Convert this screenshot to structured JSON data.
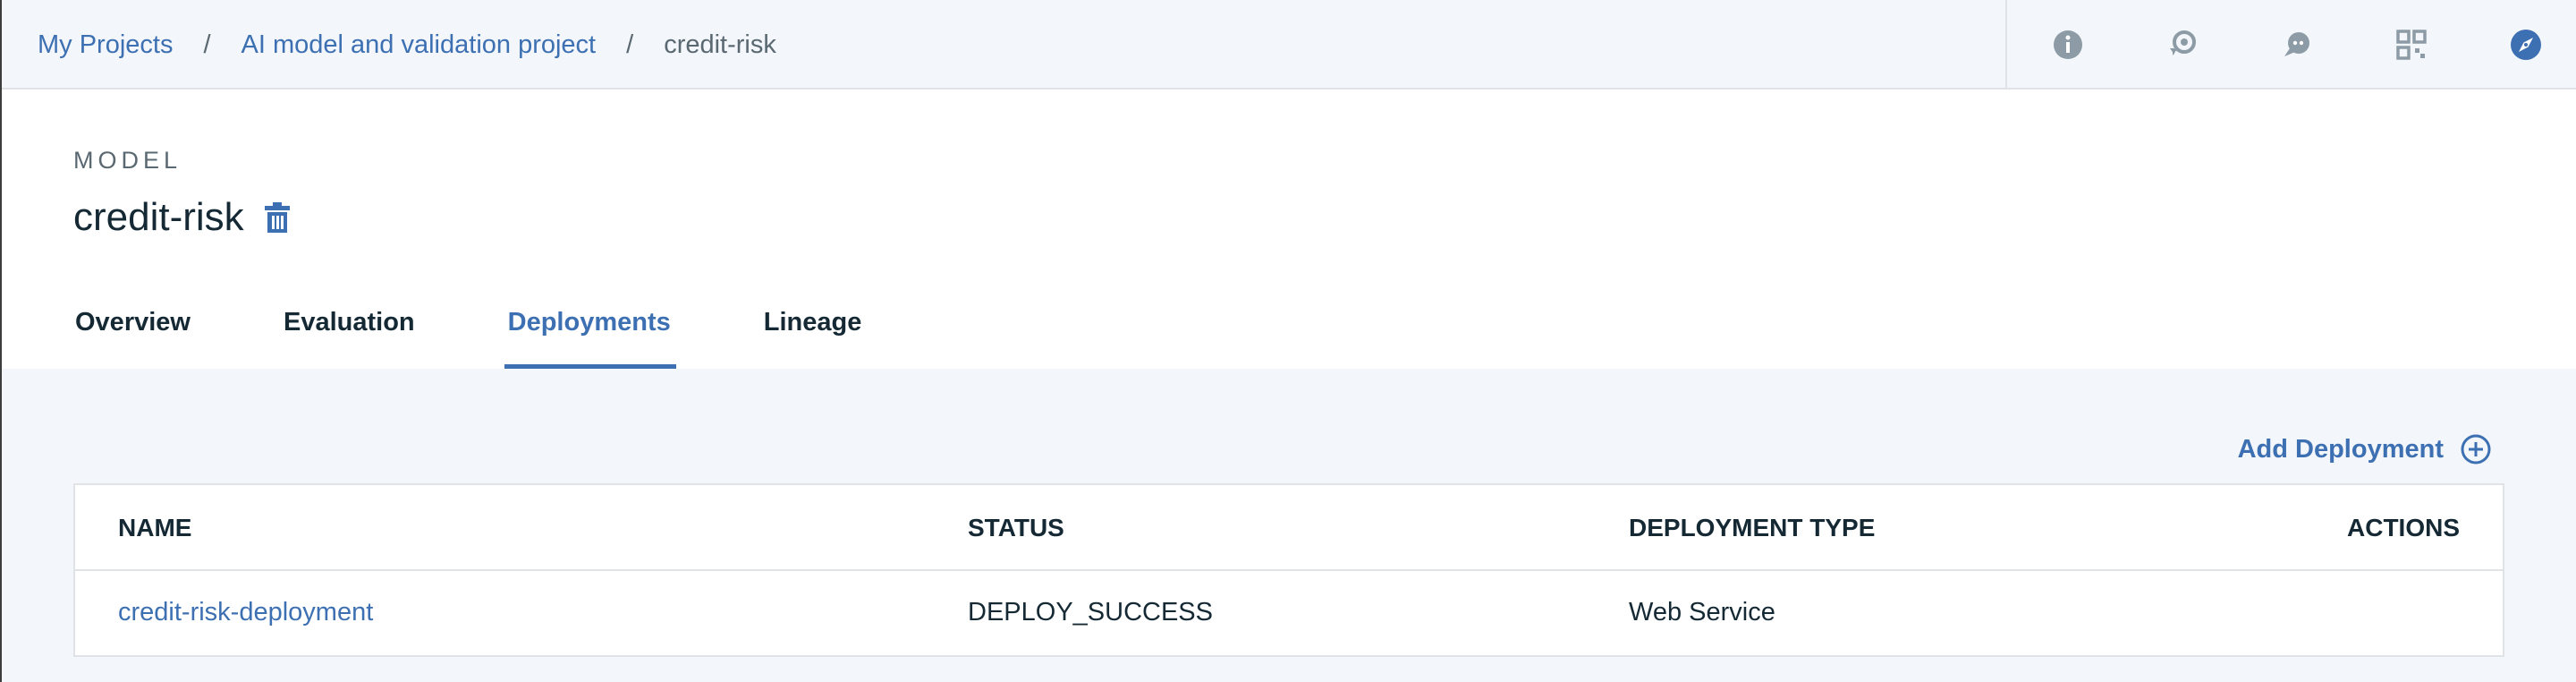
{
  "breadcrumb": {
    "items": [
      "My Projects",
      "AI model and validation project"
    ],
    "separator": "/",
    "current": "credit-risk"
  },
  "toolbar": {
    "icons": [
      "info-icon",
      "history-icon",
      "chat-icon",
      "qr-code-icon",
      "compass-icon"
    ]
  },
  "header": {
    "eyebrow": "MODEL",
    "title": "credit-risk"
  },
  "tabs": [
    "Overview",
    "Evaluation",
    "Deployments",
    "Lineage"
  ],
  "active_tab": "Deployments",
  "actions": {
    "add_deployment": "Add Deployment"
  },
  "table": {
    "columns": [
      "NAME",
      "STATUS",
      "DEPLOYMENT TYPE",
      "ACTIONS"
    ],
    "rows": [
      [
        "credit-risk-deployment",
        "DEPLOY_SUCCESS",
        "Web Service",
        ""
      ]
    ]
  },
  "colors": {
    "accent": "#3d70b2",
    "text": "#152935",
    "muted": "#5a6872",
    "page_bg": "#f3f6fa",
    "border": "#dfe3e6"
  }
}
